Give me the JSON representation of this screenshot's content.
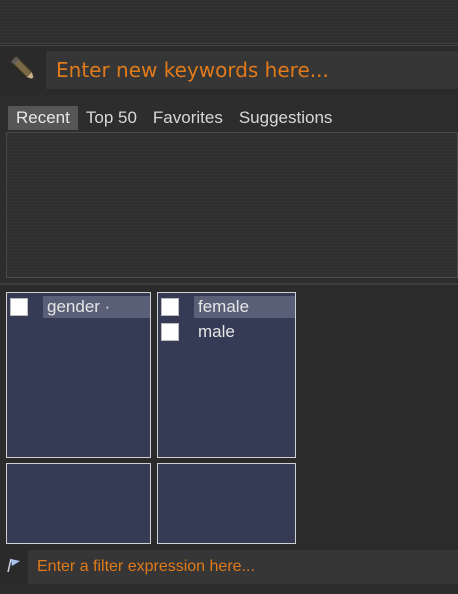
{
  "keyword_bar": {
    "placeholder": "Enter new keywords here...",
    "icon": "pencil-icon"
  },
  "tabs": [
    {
      "label": "Recent",
      "active": true
    },
    {
      "label": "Top 50",
      "active": false
    },
    {
      "label": "Favorites",
      "active": false
    },
    {
      "label": "Suggestions",
      "active": false
    }
  ],
  "facet_panels": {
    "attribute": {
      "items": [
        {
          "label": "gender ·",
          "checked": false
        }
      ]
    },
    "values": {
      "items": [
        {
          "label": "female",
          "checked": false
        },
        {
          "label": "male",
          "checked": false
        }
      ]
    }
  },
  "filter_bar": {
    "placeholder": "Enter a filter expression here...",
    "icon": "flag-icon"
  },
  "colors": {
    "accent": "#e07a1a",
    "panel": "#353a55",
    "highlight": "#5a5f78"
  }
}
